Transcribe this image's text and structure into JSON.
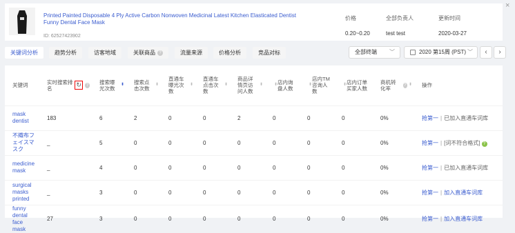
{
  "product": {
    "title": "Printed Painted Disposable 4 Ply Active Carbon Nonwoven Medicinal Latest Kitchen Elasticated Dentist Funny Dental Face Mask",
    "id": "ID: 62527423902",
    "metrics": [
      {
        "label": "价格",
        "value": "0.20~0.20"
      },
      {
        "label": "全部负责人",
        "value": "test test"
      },
      {
        "label": "更新时间",
        "value": "2020-03-27"
      }
    ]
  },
  "tabs": [
    {
      "label": "关键词分析"
    },
    {
      "label": "趋势分析"
    },
    {
      "label": "访客地域"
    },
    {
      "label": "关联商品"
    },
    {
      "label": "流量来源"
    },
    {
      "label": "价格分析"
    },
    {
      "label": "竞品对标"
    }
  ],
  "filters": {
    "terminal": "全部终端",
    "date": "2020 第15周 (PST)"
  },
  "icons": {
    "close": "×",
    "chevron_down": "﹀",
    "prev": "‹",
    "next": "›",
    "sort": "⬍",
    "refresh": "↻"
  },
  "table": {
    "headers": [
      "关键词",
      "实时搜索排名",
      "搜索曝光次数",
      "搜索点击次数",
      "直通车曝光次数",
      "直通车点击次数",
      "商品详情页访问人数",
      "店内询盘人数",
      "店内TM咨询人数",
      "店内订单买家人数",
      "商机转化率",
      "操作"
    ],
    "rows": [
      {
        "keyword": "mask dentist",
        "cells": [
          "183",
          "6",
          "2",
          "0",
          "0",
          "2",
          "0",
          "0",
          "0",
          "0%"
        ],
        "action1": "抢第一",
        "action2": "已加入直通车词库"
      },
      {
        "keyword": "不織布フェイスマスク",
        "cells": [
          "_",
          "5",
          "0",
          "0",
          "0",
          "0",
          "0",
          "0",
          "0",
          "0%"
        ],
        "action1": "抢第一",
        "action2": "[词不符合格式]"
      },
      {
        "keyword": "medicine mask",
        "cells": [
          "_",
          "4",
          "0",
          "0",
          "0",
          "0",
          "0",
          "0",
          "0",
          "0%"
        ],
        "action1": "抢第一",
        "action2": "已加入直通车词库"
      },
      {
        "keyword": "surgical masks printed",
        "cells": [
          "_",
          "3",
          "0",
          "0",
          "0",
          "0",
          "0",
          "0",
          "0",
          "0%"
        ],
        "action1": "抢第一",
        "action2": "加入直通车词库"
      },
      {
        "keyword": "funny dental face mask",
        "cells": [
          "27",
          "3",
          "0",
          "0",
          "0",
          "0",
          "0",
          "0",
          "0",
          "0%"
        ],
        "action1": "抢第一",
        "action2": "加入直通车词库"
      }
    ]
  },
  "colors": {
    "accent": "#3a5ccf",
    "highlight_border": "#e00000"
  }
}
